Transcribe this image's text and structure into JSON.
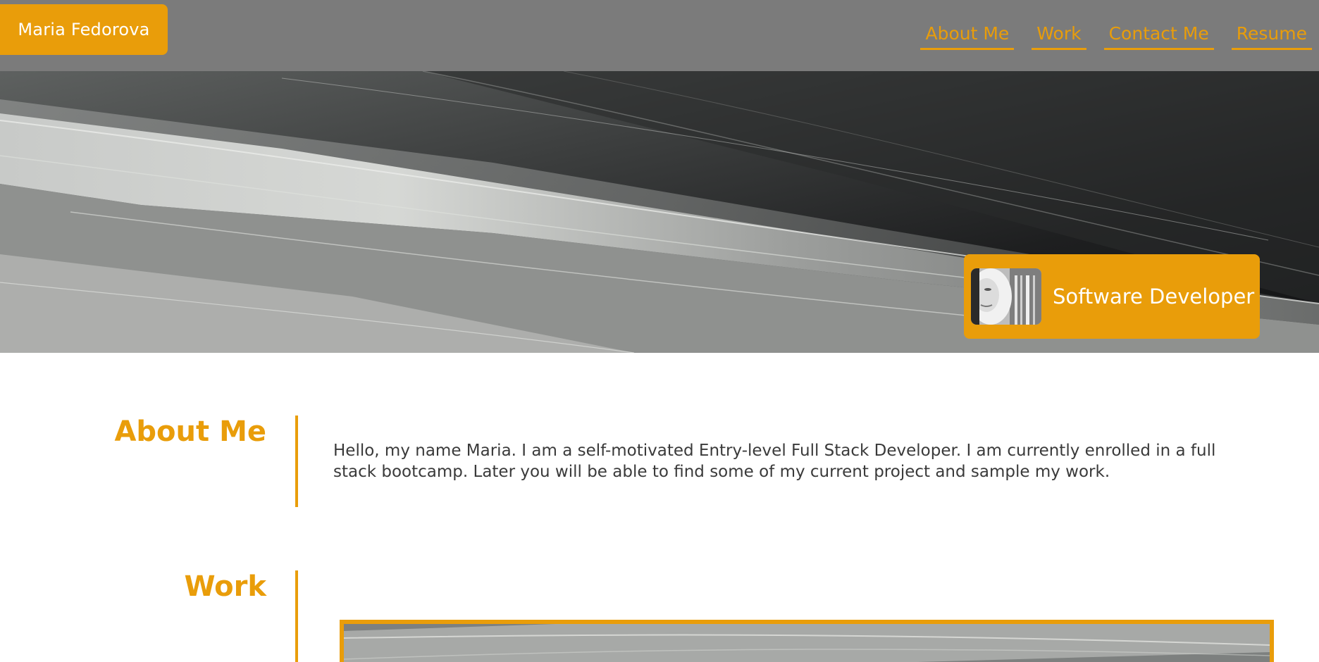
{
  "header": {
    "brand": "Maria Fedorova",
    "nav": [
      "About Me",
      "Work",
      "Contact Me",
      "Resume"
    ]
  },
  "hero": {
    "role": "Software Developer"
  },
  "about": {
    "title": "About Me",
    "text": "Hello, my name Maria. I am a self-motivated Entry-level Full Stack Developer. I am currently enrolled in a full stack bootcamp. Later you will be able to find some of my current project and sample my work."
  },
  "work": {
    "title": "Work"
  },
  "colors": {
    "accent": "#e99d0a",
    "header_bg": "#7b7b7b",
    "text": "#3a3a3a"
  }
}
